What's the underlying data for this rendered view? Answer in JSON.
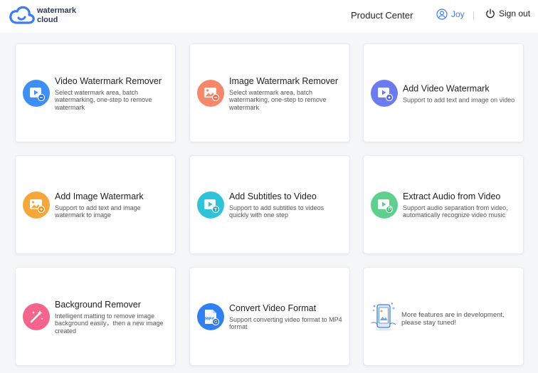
{
  "header": {
    "logo_line1": "watermark",
    "logo_line2": "cloud",
    "product_center": "Product Center",
    "user_name": "Joy",
    "sign_out": "Sign out"
  },
  "colors": {
    "accent": "#3b7cf6",
    "background": "#f5f6f8"
  },
  "cards": [
    {
      "title": "Video Watermark Remover",
      "desc": "Select watermark area, batch watermarking, one-step to remove watermark",
      "icon": "video-icon",
      "color": "#3d8ef5"
    },
    {
      "title": "Image Watermark Remover",
      "desc": "Select watermark area, batch watermarking, one-step to remove watermark",
      "icon": "image-icon",
      "color": "#f7876a"
    },
    {
      "title": "Add Video Watermark",
      "desc": "Support to add text and image on video",
      "icon": "video-add-icon",
      "color": "#6b7cf0"
    },
    {
      "title": "Add Image Watermark",
      "desc": "Support to add text and image watermark to image",
      "icon": "image-add-icon",
      "color": "#f6a73a"
    },
    {
      "title": "Add Subtitles to Video",
      "desc": "Support to add subtitles to videos quickly with one step",
      "icon": "subtitles-icon",
      "color": "#2ec3d8"
    },
    {
      "title": "Extract Audio from Video",
      "desc": "Support audio separation from video, automatically recognize video music",
      "icon": "audio-icon",
      "color": "#5cd08c"
    },
    {
      "title": "Background Remover",
      "desc": "Intelligent matting to remove image background easily，then a new image created",
      "icon": "magic-wand-icon",
      "color": "#f5648c"
    },
    {
      "title": "Convert Video Format",
      "desc": "Support converting video format to MP4 format",
      "icon": "mp4-file-icon",
      "color": "#2f80f2",
      "icon_label": "MP4"
    },
    {
      "desc": "More features are in development, please stay tuned!",
      "icon": "development-illustration-icon"
    }
  ]
}
